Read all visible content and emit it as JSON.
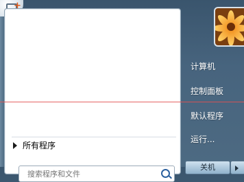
{
  "left_pane": {
    "all_programs": "所有程序",
    "search_placeholder": "搜索程序和文件"
  },
  "right_pane": {
    "items": [
      "计算机",
      "控制面板",
      "默认程序",
      "运行..."
    ]
  },
  "footer": {
    "shutdown": "关机"
  },
  "icons": {
    "app": "app-plus-icon",
    "search": "search-icon",
    "arrow": "chevron-right-icon"
  },
  "colors": {
    "overlay_line": "#e25151",
    "accent": "#2a5f9e"
  }
}
